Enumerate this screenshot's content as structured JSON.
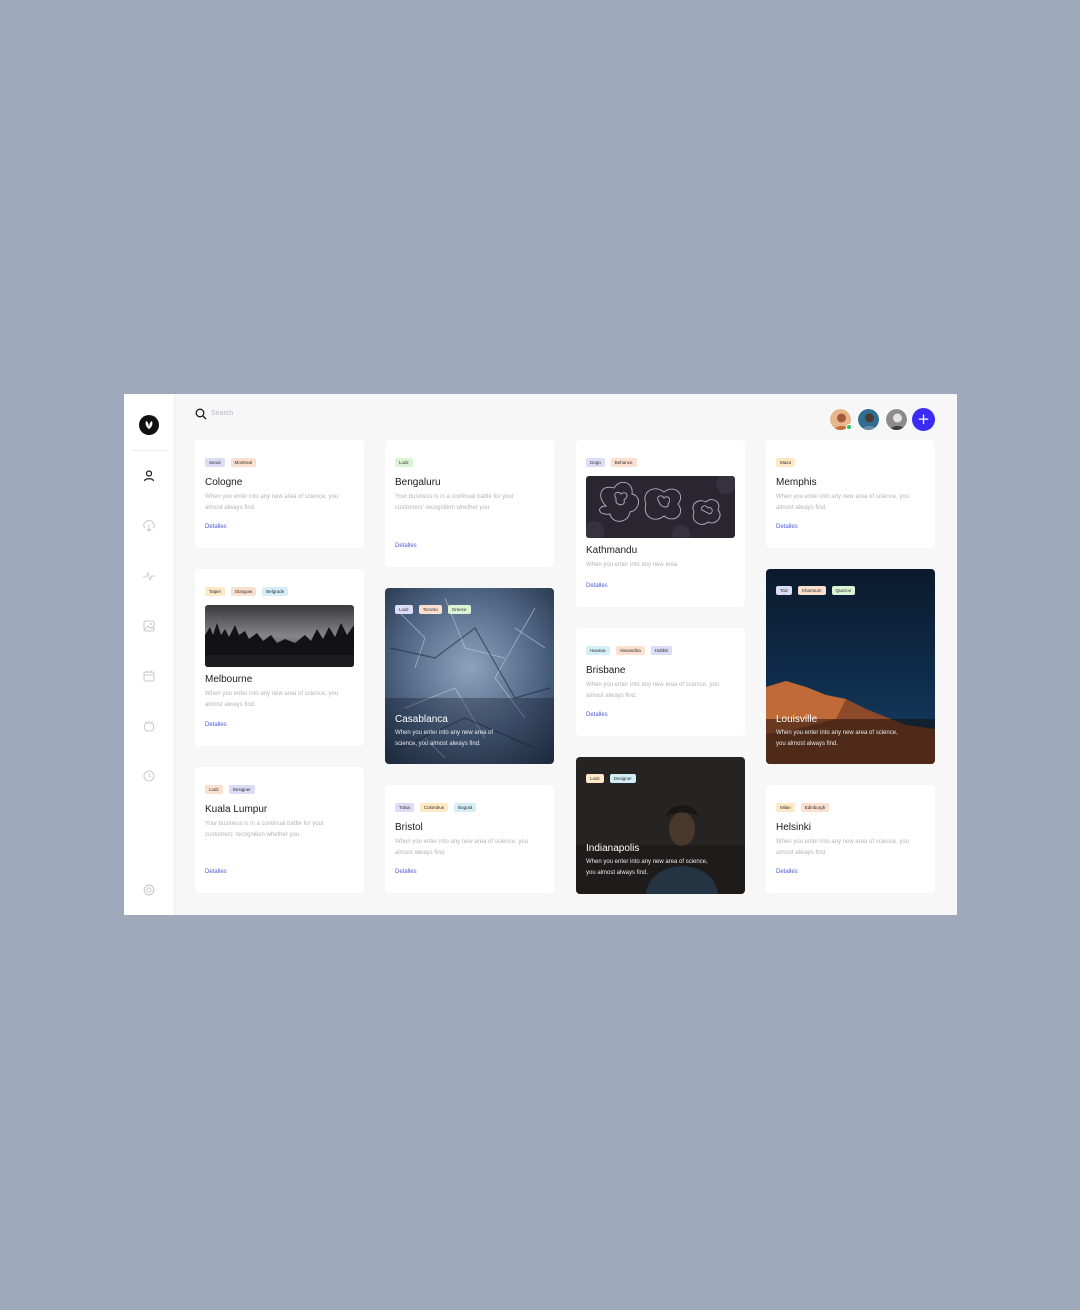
{
  "search": {
    "placeholder": "Search"
  },
  "colors": {
    "accent": "#3b2cf4",
    "link": "#4a5bd8",
    "online": "#29c45e"
  },
  "icons": [
    "logo-icon",
    "user-icon",
    "download-icon",
    "activity-icon",
    "image-icon",
    "calendar-icon",
    "ticket-icon",
    "clock-icon",
    "settings-icon",
    "search-icon",
    "plus-icon"
  ],
  "header": {
    "add_label": "+"
  },
  "cards": {
    "cologne": {
      "tags": [
        "Seoul",
        "Montreal"
      ],
      "title": "Cologne",
      "desc": "When you enter into any new area of science, you almost always find.",
      "link": "Detalles"
    },
    "bengaluru": {
      "tags": [
        "Lodz"
      ],
      "title": "Bengaluru",
      "desc": "Your business is in a continual battle for your customers' recognition whether you",
      "link": "Detalles"
    },
    "kathmandu": {
      "tags": [
        "Dogo",
        "Behance"
      ],
      "title": "Kathmandu",
      "desc": "When you enter into any new area",
      "link": "Detalles"
    },
    "memphis": {
      "tags": [
        "Maza"
      ],
      "title": "Memphis",
      "desc": "When you enter into any new area of science, you almost always find.",
      "link": "Detalles"
    },
    "melbourne": {
      "tags": [
        "Taipei",
        "Glasgow",
        "Belgrade"
      ],
      "title": "Melbourne",
      "desc": "When you enter into any new area of science, you almost always find.",
      "link": "Detalles"
    },
    "casablanca": {
      "tags": [
        "Lodz",
        "Toronto",
        "Greece"
      ],
      "title": "Casablanca",
      "desc": "When you enter into any new area of science, you almost always find."
    },
    "brisbane": {
      "tags": [
        "Havana",
        "Alexandria",
        "Hobbit"
      ],
      "title": "Brisbane",
      "desc": "When you enter into any new area of science, you almost always find.",
      "link": "Detalles"
    },
    "louisville": {
      "tags": [
        "Taiz",
        "Khartoum",
        "Quezon"
      ],
      "title": "Louisville",
      "desc": "When you enter into any new area of science, you almost always find."
    },
    "kuala": {
      "tags": [
        "Lodz",
        "Designer"
      ],
      "title": "Kuala Lumpur",
      "desc": "Your business is in a continual battle for your customers' recognition whether you",
      "link": "Detalles"
    },
    "bristol": {
      "tags": [
        "Tulsa",
        "Colombus",
        "Bogotá"
      ],
      "title": "Bristol",
      "desc": "When you enter into any new area of science, you almost always find.",
      "link": "Detalles"
    },
    "indianapolis": {
      "tags": [
        "Lodz",
        "Designer"
      ],
      "title": "Indianapolis",
      "desc": "When you enter into any new area of science, you almost always find."
    },
    "helsinki": {
      "tags": [
        "Milan",
        "Edinburgh"
      ],
      "title": "Helsinki",
      "desc": "When you enter into any new area of science, you almost always find.",
      "link": "Detalles"
    }
  }
}
